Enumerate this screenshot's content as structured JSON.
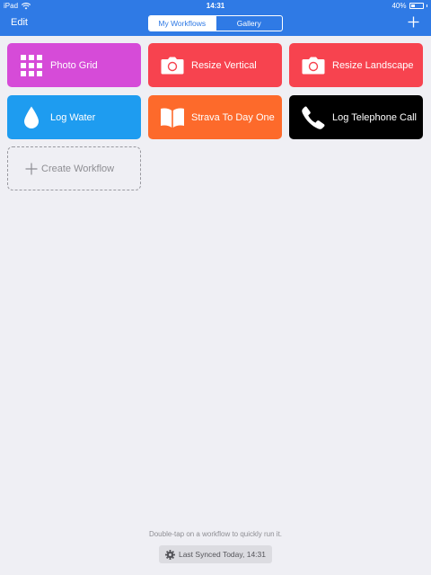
{
  "status_bar": {
    "carrier": "iPad",
    "time": "14:31",
    "battery_text": "40%",
    "battery_level": 0.4
  },
  "nav": {
    "edit_label": "Edit",
    "segments": [
      "My Workflows",
      "Gallery"
    ],
    "active_segment": "My Workflows"
  },
  "workflows": [
    {
      "label": "Photo Grid",
      "color": "#d64bd8",
      "icon": "grid-icon"
    },
    {
      "label": "Resize Vertical",
      "color": "#f7434f",
      "icon": "camera-icon"
    },
    {
      "label": "Resize Landscape",
      "color": "#f7434f",
      "icon": "camera-icon"
    },
    {
      "label": "Log Water",
      "color": "#1e9cf0",
      "icon": "water-drop-icon"
    },
    {
      "label": "Strava To Day One",
      "color": "#fd6a2b",
      "icon": "book-icon"
    },
    {
      "label": "Log Telephone Call",
      "color": "#000000",
      "icon": "phone-icon"
    }
  ],
  "create_label": "Create Workflow",
  "footer": {
    "hint": "Double-tap on a workflow to quickly run it.",
    "sync_label": "Last Synced Today, 14:31"
  },
  "colors": {
    "header": "#2f7ae5",
    "background": "#efeff4"
  }
}
